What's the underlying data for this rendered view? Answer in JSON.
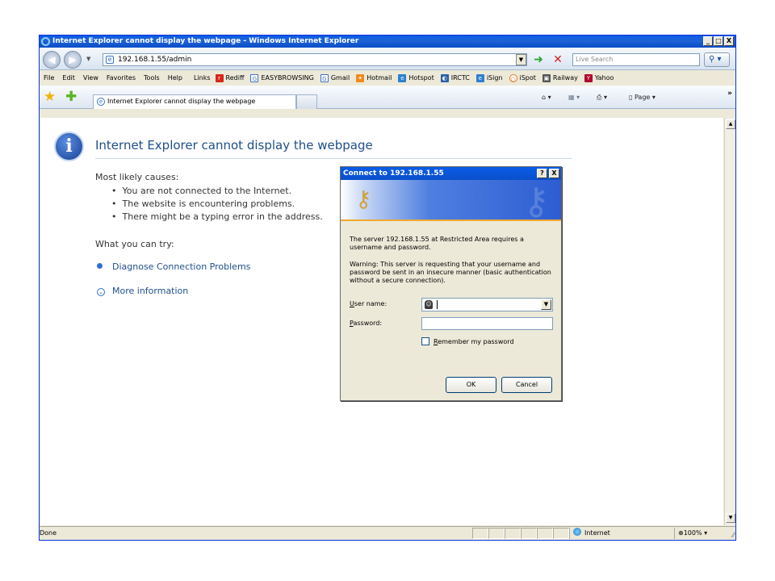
{
  "window": {
    "title": "Internet Explorer cannot display the webpage - Windows Internet Explorer",
    "controls": {
      "minimize": "_",
      "maximize": "□",
      "close": "X"
    }
  },
  "address_bar": {
    "url": "192.168.1.55/admin",
    "search_placeholder": "Live Search"
  },
  "menu": [
    "File",
    "Edit",
    "View",
    "Favorites",
    "Tools",
    "Help"
  ],
  "links_label": "Links",
  "links": [
    {
      "label": "Rediff",
      "icon": "rediff-icon",
      "color": "#d8261a"
    },
    {
      "label": "EASYBROWSING",
      "icon": "google-icon",
      "color": "#3e6fc6"
    },
    {
      "label": "Gmail",
      "icon": "google-icon",
      "color": "#3e6fc6"
    },
    {
      "label": "Hotmail",
      "icon": "msn-butterfly-icon",
      "color": "#f08a1c"
    },
    {
      "label": "Hotspot",
      "icon": "ie-page-icon",
      "color": "#2f7fd0"
    },
    {
      "label": "IRCTC",
      "icon": "irctc-icon",
      "color": "#2a5fa8"
    },
    {
      "label": "iSign",
      "icon": "ie-page-icon",
      "color": "#2f7fd0"
    },
    {
      "label": "iSpot",
      "icon": "ispot-icon",
      "color": "#d97a20"
    },
    {
      "label": "Railway",
      "icon": "train-icon",
      "color": "#555555"
    },
    {
      "label": "Yahoo",
      "icon": "yahoo-icon",
      "color": "#b3002d"
    }
  ],
  "tab": {
    "title": "Internet Explorer cannot display the webpage"
  },
  "command_bar": {
    "page_label": "Page"
  },
  "error_page": {
    "title": "Internet Explorer cannot display the webpage",
    "causes_heading": "Most likely causes:",
    "causes": [
      "You are not connected to the Internet.",
      "The website is encountering problems.",
      "There might be a typing error in the address."
    ],
    "try_heading": "What you can try:",
    "diagnose_link": "Diagnose Connection Problems",
    "more_info_link": "More information"
  },
  "status_bar": {
    "status": "Done",
    "zone": "Internet",
    "zoom": "100%"
  },
  "dialog": {
    "title": "Connect to 192.168.1.55",
    "controls": {
      "help": "?",
      "close": "X"
    },
    "message": "The server 192.168.1.55 at Restricted Area requires a username and password.",
    "warning": "Warning: This server is requesting that your username and password be sent in an insecure manner (basic authentication without a secure connection).",
    "username_label_accel": "U",
    "username_label_rest": "ser name:",
    "password_label_accel": "P",
    "password_label_rest": "assword:",
    "remember_accel": "R",
    "remember_rest": "emember my password",
    "ok_label": "OK",
    "cancel_label": "Cancel"
  }
}
